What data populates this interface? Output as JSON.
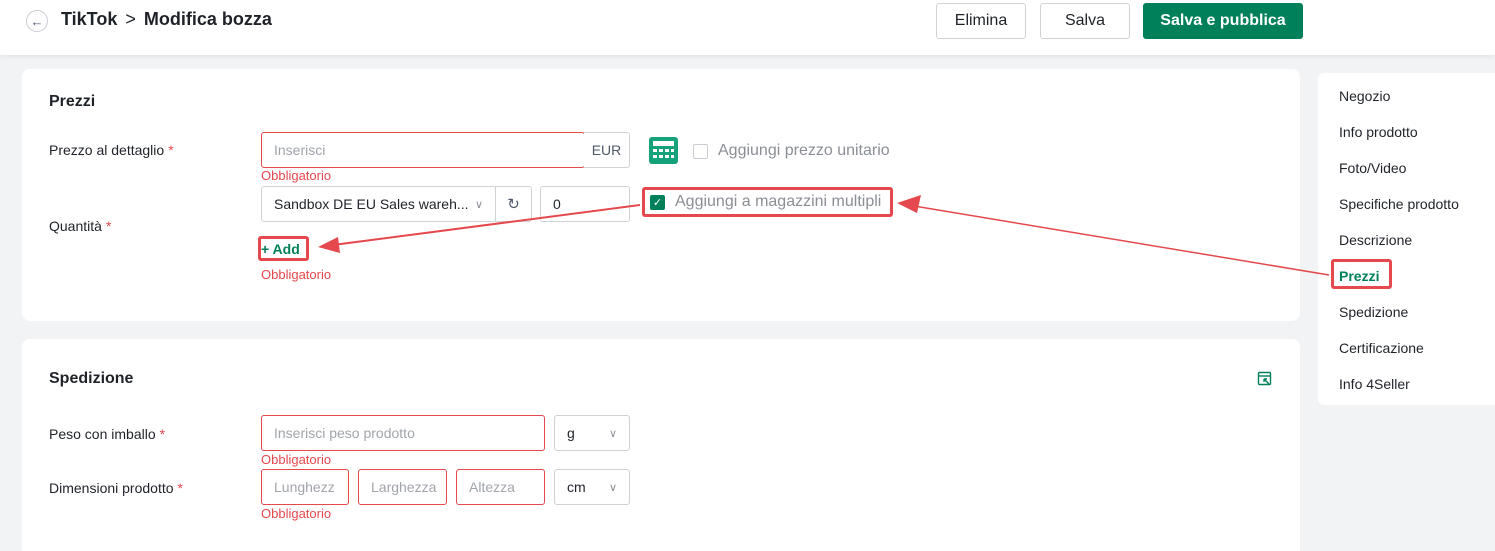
{
  "header": {
    "app": "TikTok",
    "separator": ">",
    "page": "Modifica bozza",
    "buttons": {
      "delete": "Elimina",
      "save": "Salva",
      "save_publish": "Salva e pubblica"
    }
  },
  "prices": {
    "title": "Prezzi",
    "retail_label": "Prezzo al dettaglio",
    "retail_placeholder": "Inserisci",
    "currency": "EUR",
    "unit_price_label": "Aggiungi prezzo unitario",
    "unit_price_checked": false,
    "required_msg": "Obbligatorio",
    "quantity_label": "Quantità",
    "warehouse": "Sandbox DE EU Sales wareh...",
    "quantity_value": "0",
    "multi_warehouse_label": "Aggiungi a magazzini multipli",
    "multi_warehouse_checked": true,
    "add_label": "+ Add"
  },
  "shipping": {
    "title": "Spedizione",
    "weight_label": "Peso con imballo",
    "weight_placeholder": "Inserisci peso prodotto",
    "weight_unit": "g",
    "dimensions_label": "Dimensioni prodotto",
    "length_placeholder": "Lunghezz",
    "width_placeholder": "Larghezza",
    "height_placeholder": "Altezza",
    "dimension_unit": "cm",
    "required_msg": "Obbligatorio"
  },
  "nav": {
    "items": [
      "Negozio",
      "Info prodotto",
      "Foto/Video",
      "Specifiche prodotto",
      "Descrizione",
      "Prezzi",
      "Spedizione",
      "Certificazione",
      "Info 4Seller"
    ],
    "active": "Prezzi"
  },
  "colors": {
    "brand": "#00805a",
    "error": "#e5484d",
    "annotation": "#e5484d"
  }
}
